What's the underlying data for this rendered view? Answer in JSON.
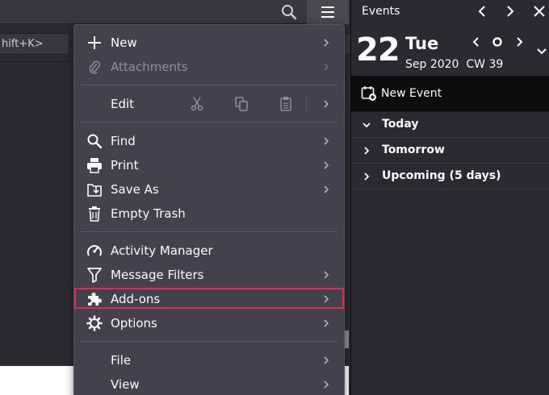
{
  "toolbar": {
    "search_icon": "search-icon",
    "menu_icon": "hamburger-menu-icon",
    "quick_filter_shortcut": "hift+K>"
  },
  "app_menu": {
    "items": [
      {
        "label": "New",
        "icon": "plus-icon",
        "submenu": true,
        "enabled": true
      },
      {
        "label": "Attachments",
        "icon": "paperclip-icon",
        "submenu": true,
        "enabled": false
      },
      {
        "label": "Edit",
        "icon": "",
        "submenu": true,
        "enabled": true
      },
      {
        "label": "Find",
        "icon": "magnifier-icon",
        "submenu": true,
        "enabled": true
      },
      {
        "label": "Print",
        "icon": "printer-icon",
        "submenu": true,
        "enabled": true
      },
      {
        "label": "Save As",
        "icon": "save-icon",
        "submenu": true,
        "enabled": true
      },
      {
        "label": "Empty Trash",
        "icon": "trash-icon",
        "submenu": false,
        "enabled": true
      },
      {
        "label": "Activity Manager",
        "icon": "gauge-icon",
        "submenu": false,
        "enabled": true
      },
      {
        "label": "Message Filters",
        "icon": "filter-icon",
        "submenu": true,
        "enabled": true
      },
      {
        "label": "Add-ons",
        "icon": "puzzle-icon",
        "submenu": true,
        "enabled": true,
        "highlighted": true
      },
      {
        "label": "Options",
        "icon": "gear-icon",
        "submenu": true,
        "enabled": true
      },
      {
        "label": "File",
        "icon": "",
        "submenu": true,
        "enabled": true
      },
      {
        "label": "View",
        "icon": "",
        "submenu": true,
        "enabled": true
      }
    ],
    "edit_tools": [
      "cut-icon",
      "copy-icon",
      "paste-icon"
    ]
  },
  "events": {
    "title": "Events",
    "day_number": "22",
    "day_name": "Tue",
    "month_year": "Sep 2020",
    "calendar_week": "CW 39",
    "new_event_label": "New Event",
    "sections": [
      {
        "label": "Today",
        "expanded": true
      },
      {
        "label": "Tomorrow",
        "expanded": false
      },
      {
        "label": "Upcoming (5 days)",
        "expanded": false
      }
    ]
  },
  "colors": {
    "menu_bg": "#42414d",
    "highlight_border": "#e22850",
    "events_bg": "#2b2a33"
  }
}
